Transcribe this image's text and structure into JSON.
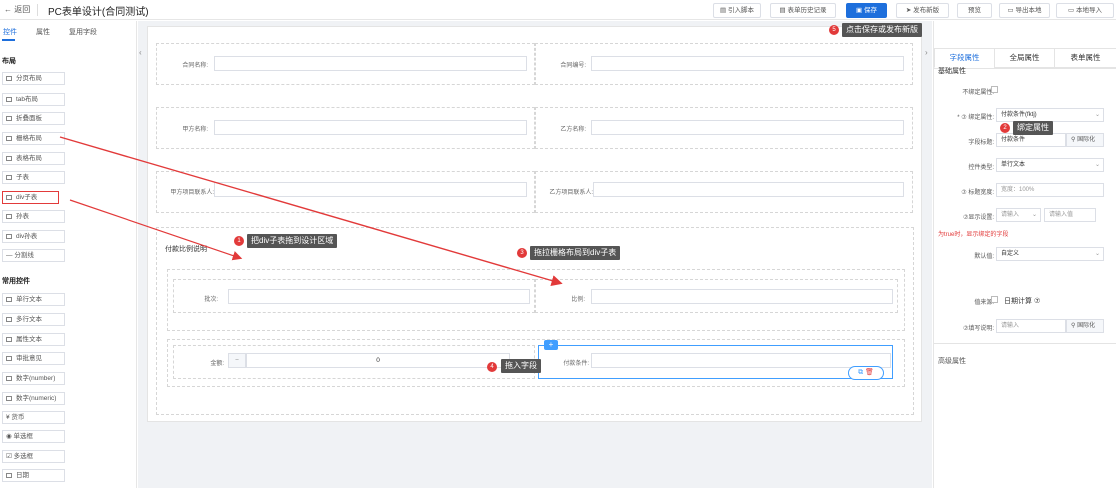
{
  "header": {
    "back_label": "← 返回",
    "title": "PC表单设计(合同测试)",
    "buttons": [
      "引入脚本",
      "表单历史记录",
      "保存",
      "发布新版",
      "预览",
      "导出本地",
      "本地导入"
    ]
  },
  "left_panel": {
    "tabs": [
      "控件",
      "属性",
      "复用字段"
    ],
    "layout_title": "布局",
    "layout_items": [
      "分页布局",
      "tab布局",
      "折叠面板",
      "栅格布局",
      "表格布局",
      "子表",
      "div子表",
      "孙表",
      "div孙表",
      "分割线"
    ],
    "common_title": "常用控件",
    "common_items": [
      "单行文本",
      "多行文本",
      "属性文本",
      "审批意见",
      "数字(number)",
      "数字(numeric)",
      "货币",
      "单选框",
      "多选框",
      "日期"
    ]
  },
  "form": {
    "fields": [
      {
        "label": "合同名称:"
      },
      {
        "label": "合同编号:"
      },
      {
        "label": "甲方名称:"
      },
      {
        "label": "乙方名称:"
      },
      {
        "label": "甲方项目联系人:"
      },
      {
        "label": "乙方项目联系人:"
      }
    ],
    "section_title": "付款比例说明",
    "sub_fields": [
      {
        "label": "批次:"
      },
      {
        "label": "比例:"
      }
    ],
    "amount_label": "金额:",
    "amount_minus": "−",
    "amount_value": "0",
    "condition_label": "付款条件:",
    "drag_icon": "+"
  },
  "right_panel": {
    "tabs": [
      "字段属性",
      "全局属性",
      "表单属性"
    ],
    "basic_title": "基础属性",
    "rows": [
      {
        "label": "不绑定属性:",
        "type": "checkbox"
      },
      {
        "label": "* ⑦ 绑定属性:",
        "type": "select",
        "value": "付款条件(fktj)"
      },
      {
        "label": "字段标题:",
        "type": "input-btn",
        "value": "付款条件",
        "button": "国际化"
      },
      {
        "label": "控件类型:",
        "type": "select",
        "value": "单行文本"
      },
      {
        "label": "⑦ 标题宽度:",
        "type": "input",
        "placeholder": "宽度：100%"
      },
      {
        "label": "⑦显示设置:",
        "type": "double",
        "placeholder": "请输入",
        "placeholder2": "请输入值"
      },
      {
        "label": "默认值:",
        "type": "select",
        "value": "自定义"
      },
      {
        "label": "值来源:",
        "type": "checkbox-text",
        "value": "日期计算 ⑦"
      },
      {
        "label": "⑦填写说明:",
        "type": "input-btn",
        "placeholder": "请输入",
        "button": "国际化"
      }
    ],
    "hint": "为true时，显示绑定的字段",
    "advanced_title": "高级属性"
  },
  "annotations": [
    {
      "num": "1",
      "text": "把div子表拖到设计区域"
    },
    {
      "num": "2",
      "text": "绑定属性"
    },
    {
      "num": "3",
      "text": "拖拉栅格布局到div子表"
    },
    {
      "num": "4",
      "text": "拖入字段"
    },
    {
      "num": "5",
      "text": "点击保存或发布新版"
    }
  ],
  "colors": {
    "accent": "#1e6fdc",
    "annotation": "#e23a3a",
    "callout": "#555555"
  }
}
